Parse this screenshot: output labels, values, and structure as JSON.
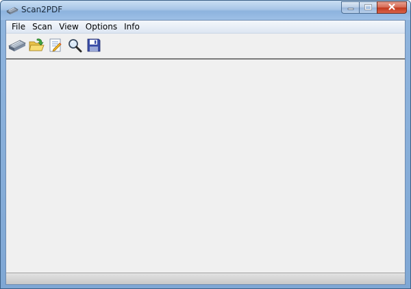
{
  "window": {
    "title": "Scan2PDF",
    "app_icon": "scanner-icon"
  },
  "caption_buttons": [
    {
      "name": "minimize",
      "icon": "minimize-icon"
    },
    {
      "name": "maximize",
      "icon": "maximize-icon"
    },
    {
      "name": "close",
      "icon": "close-icon"
    }
  ],
  "menubar": {
    "items": [
      "File",
      "Scan",
      "View",
      "Options",
      "Info"
    ]
  },
  "toolbar": {
    "buttons": [
      {
        "name": "scan",
        "icon": "scanner-icon"
      },
      {
        "name": "open",
        "icon": "open-folder-icon"
      },
      {
        "name": "edit",
        "icon": "edit-document-icon"
      },
      {
        "name": "view",
        "icon": "magnifier-icon"
      },
      {
        "name": "save",
        "icon": "floppy-disk-icon"
      }
    ]
  },
  "colors": {
    "titlebar": "#a8c6e7",
    "client_bg": "#f0f0f0",
    "close_button": "#c2391d"
  }
}
